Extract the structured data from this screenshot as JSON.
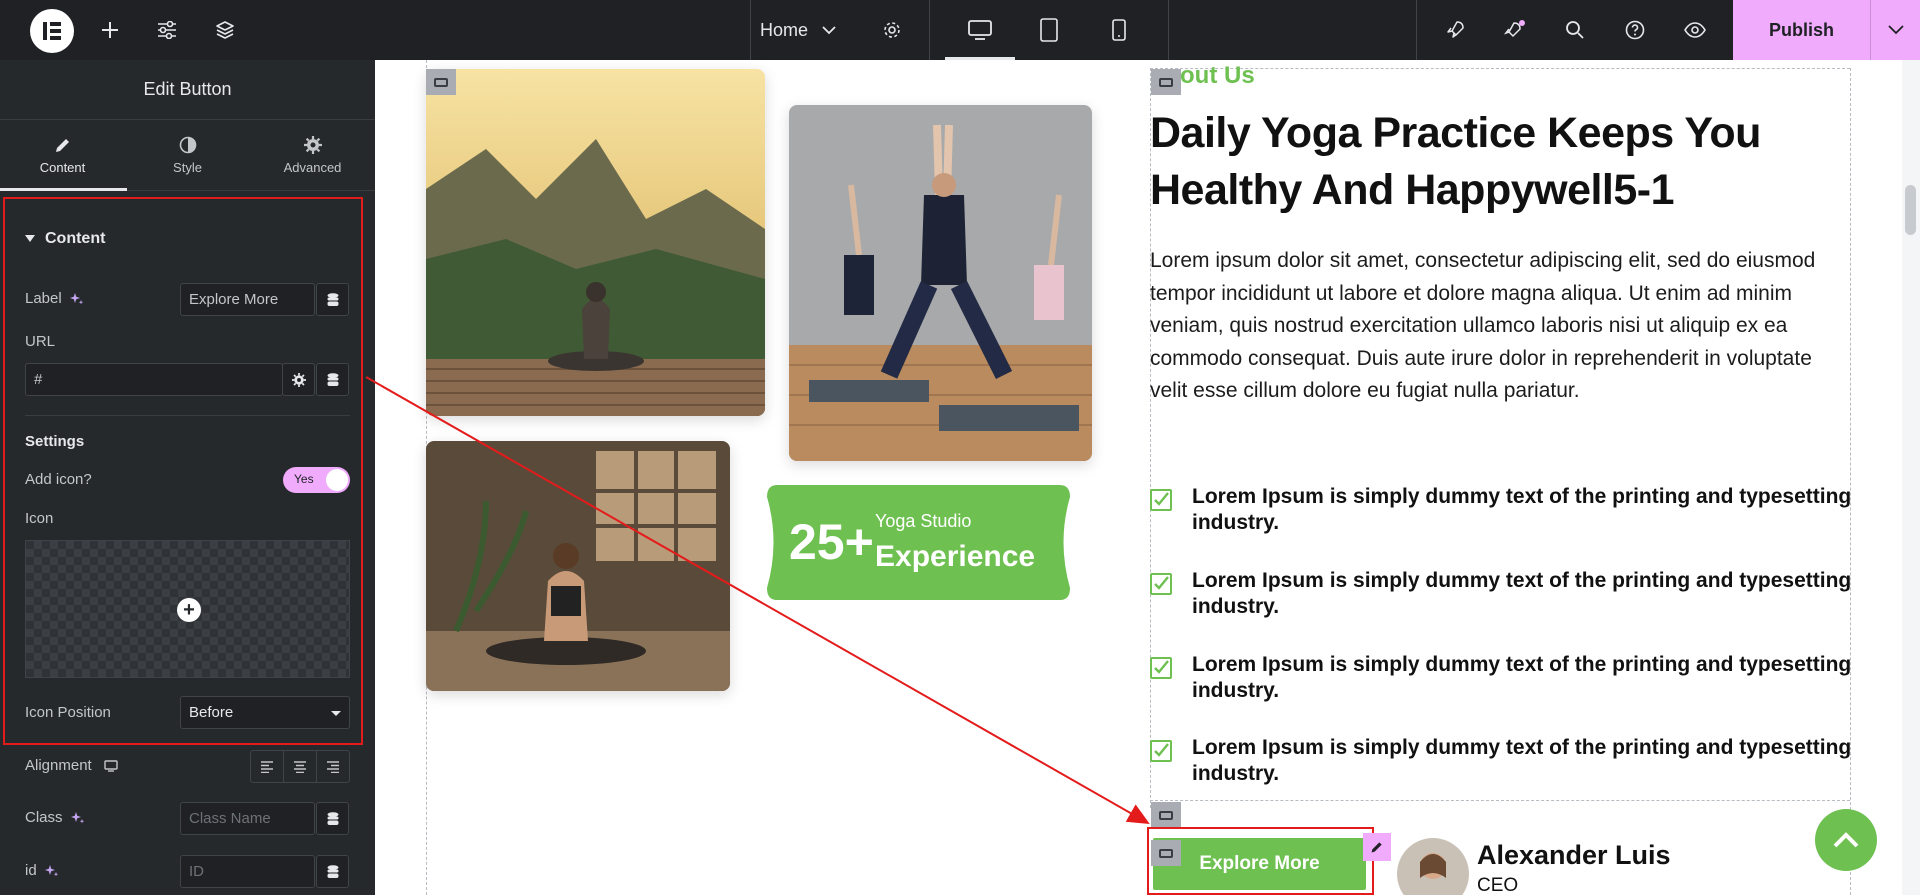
{
  "topbar": {
    "page_name": "Home",
    "publish_label": "Publish",
    "accent": "#f0abfc"
  },
  "panel": {
    "title": "Edit Button",
    "tabs": [
      {
        "label": "Content",
        "icon": "pencil-icon",
        "active": true
      },
      {
        "label": "Style",
        "icon": "half-circle-icon",
        "active": false
      },
      {
        "label": "Advanced",
        "icon": "gear-icon",
        "active": false
      }
    ],
    "content_section": "Content",
    "label_label": "Label",
    "label_value": "Explore More",
    "url_label": "URL",
    "url_value": "#",
    "settings_heading": "Settings",
    "add_icon_label": "Add icon?",
    "add_icon_value": "Yes",
    "icon_label": "Icon",
    "icon_position_label": "Icon Position",
    "icon_position_value": "Before",
    "alignment_label": "Alignment",
    "class_label": "Class",
    "class_placeholder": "Class Name",
    "id_label": "id",
    "id_placeholder": "ID"
  },
  "canvas": {
    "about_label": "out Us",
    "heading": "Daily Yoga Practice Keeps You Healthy And Happywell5-1",
    "paragraph": "Lorem ipsum dolor sit amet, consectetur adipiscing elit, sed do eiusmod tempor incididunt ut labore et dolore magna aliqua. Ut enim ad minim veniam, quis nostrud exercitation ullamco laboris nisi ut aliquip ex ea commodo consequat. Duis aute irure dolor in reprehenderit in voluptate velit esse cillum dolore eu fugiat nulla pariatur.",
    "checklist": [
      "Lorem Ipsum is simply dummy text of the printing and typesetting industry.",
      "Lorem Ipsum is simply dummy text of the printing and typesetting industry.",
      "Lorem Ipsum is simply dummy text of the printing and typesetting industry.",
      "Lorem Ipsum is simply dummy text of the printing and typesetting industry."
    ],
    "badge_number": "25+",
    "badge_line1": "Yoga Studio",
    "badge_line2": "Experience",
    "button_label": "Explore More",
    "person_name": "Alexander Luis",
    "person_role": "CEO",
    "brand_green": "#6ec051",
    "highlight_red": "#e41b1b"
  }
}
